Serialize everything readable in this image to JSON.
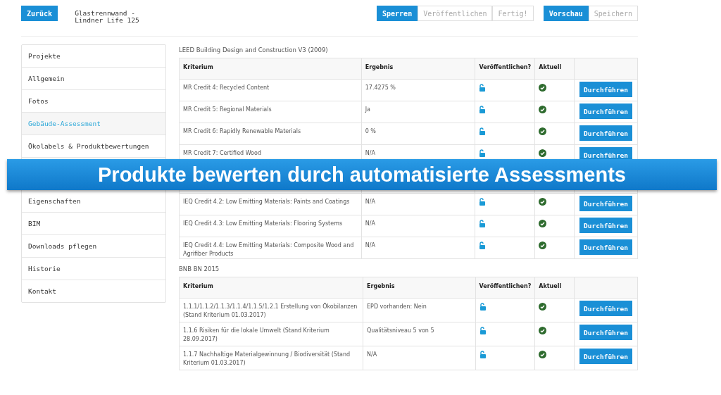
{
  "header": {
    "back_button": "Zurück",
    "product_title": [
      "Glastrennwand -",
      "Lindner Life 125"
    ],
    "button_groups": [
      [
        {
          "label": "Sperren",
          "primary": true
        },
        {
          "label": "Veröffentlichen",
          "primary": false
        },
        {
          "label": "Fertig!",
          "primary": false
        }
      ],
      [
        {
          "label": "Vorschau",
          "primary": true
        },
        {
          "label": "Speichern",
          "primary": false
        }
      ]
    ]
  },
  "sidebar": {
    "items": [
      {
        "label": "Projekte",
        "selected": false
      },
      {
        "label": "Allgemein",
        "selected": false
      },
      {
        "label": "Fotos",
        "selected": false
      },
      {
        "label": "Gebäude-Assessment",
        "selected": true
      },
      {
        "label": "Ökolabels & Produktbewertungen",
        "selected": false
      },
      {
        "covered": true
      },
      {
        "label": "Eigenschaften",
        "selected": false
      },
      {
        "label": "BIM",
        "selected": false
      },
      {
        "label": "Downloads pflegen",
        "selected": false
      },
      {
        "label": "Historie",
        "selected": false
      },
      {
        "label": "Kontakt",
        "selected": false
      }
    ]
  },
  "sections": [
    {
      "title": "LEED Building Design and Construction V3 (2009)",
      "columns": [
        "Kriterium",
        "Ergebnis",
        "Veröffentlichen?",
        "Aktuell"
      ],
      "rows": [
        {
          "criterion": "MR Credit 4: Recycled Content",
          "result": "17.4275 %",
          "action": "Durchführen"
        },
        {
          "criterion": "MR Credit 5: Regional Materials",
          "result": "Ja",
          "action": "Durchführen"
        },
        {
          "criterion": "MR Credit 6: Rapidly Renewable Materials",
          "result": "0 %",
          "action": "Durchführen"
        },
        {
          "criterion": "MR Credit 7: Certified Wood",
          "result": "N/A",
          "action": "Durchführen"
        },
        {
          "covered": true
        },
        {
          "criterion": "IEQ Credit 4.2: Low Emitting Materials: Paints and Coatings",
          "result": "N/A",
          "action": "Durchführen"
        },
        {
          "criterion": "IEQ Credit 4.3: Low Emitting Materials: Flooring Systems",
          "result": "N/A",
          "action": "Durchführen"
        },
        {
          "criterion": "IEQ Credit 4.4: Low Emitting Materials: Composite Wood and Agrifiber Products",
          "result": "N/A",
          "action": "Durchführen"
        }
      ]
    },
    {
      "title": "BNB BN 2015",
      "columns": [
        "Kriterium",
        "Ergebnis",
        "Veröffentlichen?",
        "Aktuell"
      ],
      "rows": [
        {
          "criterion": "1.1.1/1.1.2/1.1.3/1.1.4/1.1.5/1.2.1 Erstellung von Ökobilanzen (Stand Kriterium 01.03.2017)",
          "result": "EPD vorhanden: Nein",
          "action": "Durchführen"
        },
        {
          "criterion": "1.1.6 Risiken für die lokale Umwelt (Stand Kriterium 28.09.2017)",
          "result": "Qualitätsniveau 5 von 5",
          "action": "Durchführen"
        },
        {
          "criterion": "1.1.7 Nachhaltige Materialgewinnung / Biodiversität (Stand Kriterium 01.03.2017)",
          "result": "N/A",
          "action": "Durchführen"
        }
      ]
    }
  ],
  "banner": "Produkte bewerten durch automatisierte Assessments"
}
